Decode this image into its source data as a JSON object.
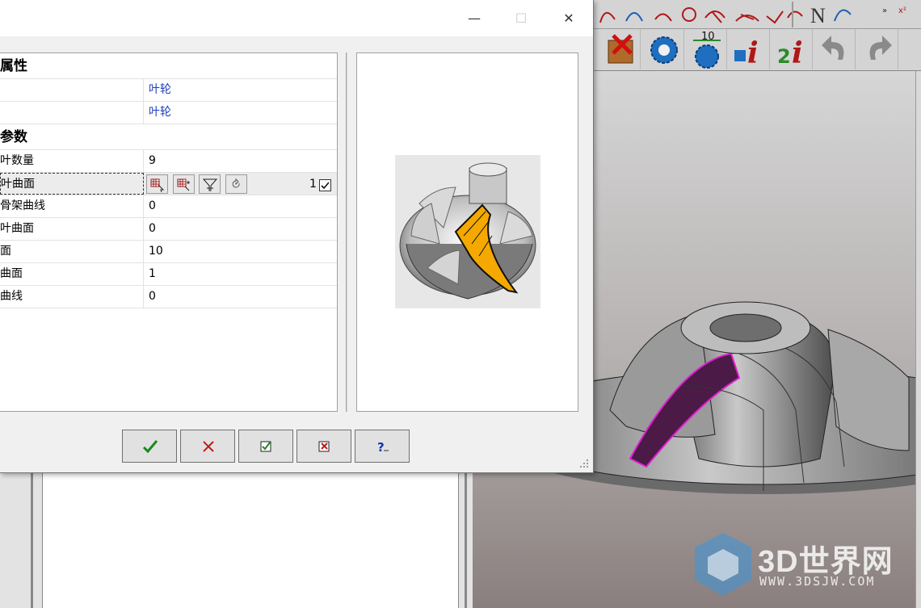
{
  "dialog": {
    "controls": {
      "minimize": "—",
      "maximize": "☐",
      "close": "✕"
    },
    "categories": [
      {
        "label": "属性",
        "rows": [
          {
            "name": "",
            "value": "叶轮"
          },
          {
            "name": "",
            "value": "叶轮"
          }
        ]
      },
      {
        "label": "参数",
        "rows": [
          {
            "name": "叶数量",
            "value": "9"
          },
          {
            "name": "叶曲面",
            "value": "",
            "selected": true
          },
          {
            "name": "骨架曲线",
            "value": "0"
          },
          {
            "name": "叶曲面",
            "value": "0"
          },
          {
            "name": "面",
            "value": "10"
          },
          {
            "name": "曲面",
            "value": "1"
          },
          {
            "name": "曲线",
            "value": "0"
          }
        ]
      }
    ],
    "blade_surface_count": "1",
    "blade_surface_checked": true,
    "cell_buttons": [
      "select-surface-icon",
      "select-multiple-icon",
      "filter-icon",
      "reset-icon"
    ],
    "buttons": [
      "ok-check-icon",
      "cancel-x-icon",
      "apply-check-icon",
      "apply-x-icon",
      "help-icon"
    ],
    "accent": {
      "blue_value": "#1f3fbf",
      "ok_green": "#1a8a1a",
      "cancel_red": "#c01818",
      "blade_orange": "#f5a800"
    }
  },
  "watermark": {
    "brand": "3D世界网",
    "url": "WWW.3DSJW.COM"
  }
}
